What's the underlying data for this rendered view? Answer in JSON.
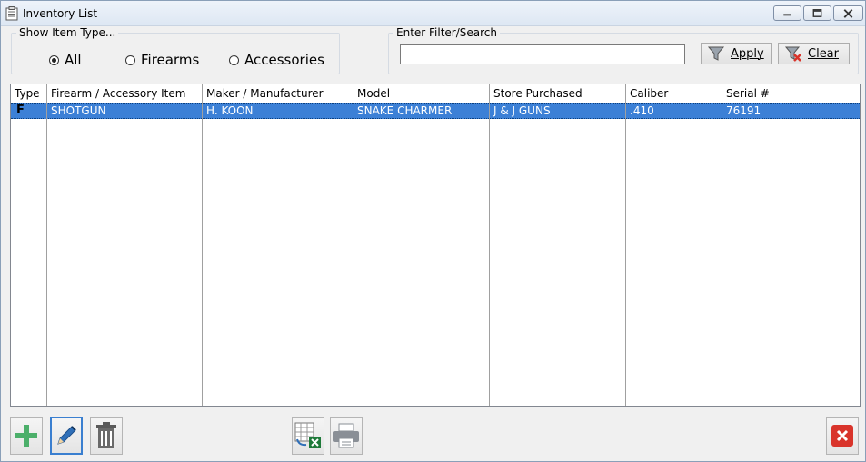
{
  "window": {
    "title": "Inventory List"
  },
  "show_type": {
    "legend": "Show Item Type...",
    "options": [
      {
        "label": "All",
        "checked": true
      },
      {
        "label": "Firearms",
        "checked": false
      },
      {
        "label": "Accessories",
        "checked": false
      }
    ]
  },
  "filter": {
    "legend": "Enter Filter/Search",
    "value": "",
    "apply_label": "Apply",
    "clear_label": "Clear"
  },
  "grid": {
    "columns": [
      "Type",
      "Firearm / Accessory Item",
      "Maker / Manufacturer",
      "Model",
      "Store Purchased",
      "Caliber",
      "Serial #"
    ],
    "rows": [
      {
        "type": "F",
        "item": "SHOTGUN",
        "maker": "H. KOON",
        "model": "SNAKE CHARMER",
        "store": "J & J GUNS",
        "caliber": ".410",
        "serial": "76191",
        "selected": true
      }
    ]
  },
  "toolbar": {
    "add": "add-icon",
    "edit": "pencil-icon",
    "delete": "trash-icon",
    "export": "export-excel-icon",
    "print": "printer-icon",
    "close": "close-icon"
  },
  "colors": {
    "selection": "#3c80d6",
    "add_green": "#4caf6a",
    "close_red": "#d9342b"
  }
}
